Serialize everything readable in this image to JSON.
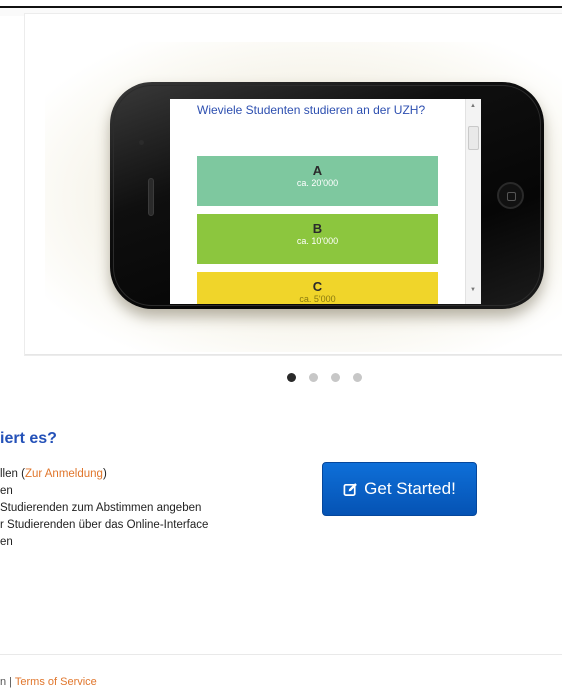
{
  "carousel": {
    "question": "Wieviele Studenten studieren an der UZH?",
    "answers": [
      {
        "letter": "A",
        "text": "ca. 20'000",
        "color": "#7ec89f"
      },
      {
        "letter": "B",
        "text": "ca. 10'000",
        "color": "#8cc63e"
      },
      {
        "letter": "C",
        "text": "ca. 5'000",
        "color": "#f0d52a"
      }
    ],
    "slide_count": 4,
    "active_slide": 1
  },
  "how_it_works": {
    "heading": "iert es?",
    "steps": [
      {
        "prefix": "llen (",
        "link": "Zur Anmeldung",
        "suffix": ")"
      },
      {
        "text": "en"
      },
      {
        "text": " Studierenden zum Abstimmen angeben"
      },
      {
        "text": "r Studierenden über das Online-Interface"
      },
      {
        "text": "en"
      }
    ]
  },
  "cta": {
    "label": "Get Started!",
    "icon": "edit-icon",
    "color": "#0a63c9"
  },
  "footer": {
    "prefix": "n | ",
    "terms_link": "Terms of Service"
  },
  "colors": {
    "link": "#e0762c",
    "heading": "#2451b8"
  }
}
